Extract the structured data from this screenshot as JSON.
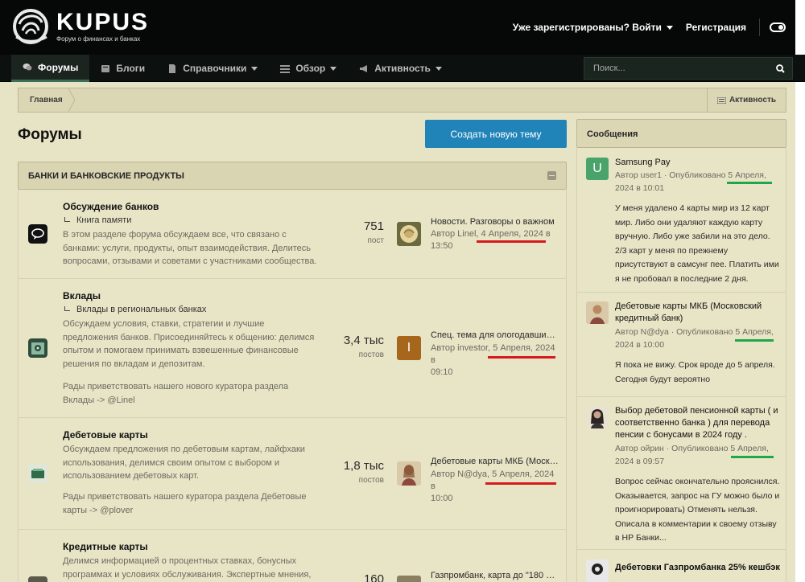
{
  "site": {
    "brand": "KUPUS",
    "tagline": "Форум о финансах и банках"
  },
  "header": {
    "login_label": "Уже зарегистрированы? Войти",
    "register_label": "Регистрация"
  },
  "nav": {
    "items": [
      {
        "label": "Форумы",
        "icon": "chat-bubbles-icon"
      },
      {
        "label": "Блоги",
        "icon": "book-icon"
      },
      {
        "label": "Справочники",
        "icon": "document-icon"
      },
      {
        "label": "Обзор",
        "icon": "list-icon"
      },
      {
        "label": "Активность",
        "icon": "megaphone-icon"
      }
    ],
    "search_placeholder": "Поиск..."
  },
  "breadcrumb": {
    "home": "Главная",
    "activity": "Активность"
  },
  "page": {
    "title": "Форумы",
    "create_button": "Создать новую тему"
  },
  "category": {
    "title": "БАНКИ И БАНКОВСКИЕ ПРОДУКТЫ"
  },
  "forums": [
    {
      "title": "Обсуждение банков",
      "subforum": "Книга памяти",
      "description": "В этом разделе форума обсуждаем все, что связано с банками: услуги, продукты, опыт взаимодействия. Делитесь вопросами, отзывами и советами с участниками сообщества.",
      "note": "",
      "count": "751",
      "count_label": "пост",
      "last_title": "Новости. Разговоры о важном",
      "last_author": "Автор Linel,",
      "last_date": "4 Апреля, 2024 в",
      "last_time": "13:50"
    },
    {
      "title": "Вклады",
      "subforum": "Вклады в региональных банках",
      "description": "Обсуждаем условия, ставки, стратегии и лучшие предложения банков. Присоединяйтесь к общению: делимся опытом и помогаем принимать взвешенные финансовые решения по вкладам и депозитам.",
      "note": "Рады приветствовать нашего нового куратора раздела Вклады -> @Linel",
      "count": "3,4 тыс",
      "count_label": "постов",
      "last_title": "Спец. тема для ологодавших ф...",
      "last_author": "Автор investor,",
      "last_date": "5 Апреля, 2024 в",
      "last_time": "09:10",
      "last_avatar_letter": "I"
    },
    {
      "title": "Дебетовые карты",
      "subforum": "",
      "description": "Обсуждаем предложения по дебетовым картам, лайфхаки использования, делимся своим опытом с выбором и использованием дебетовых карт.",
      "note": "Рады приветствовать нашего куратора раздела Дебетовые карты -> @plover",
      "count": "1,8 тыс",
      "count_label": "постов",
      "last_title": "Дебетовые карты МКБ (Моско...",
      "last_author": "Автор N@dya,",
      "last_date": "5 Апреля, 2024 в",
      "last_time": "10:00"
    },
    {
      "title": "Кредитные карты",
      "subforum": "",
      "description": "Делимся информацией о процентных ставках, бонусных программах и условиях обслуживания. Экспертные мнения,",
      "note": "",
      "count": "160",
      "count_label": "",
      "last_title": "Газпромбанк, карта до \"180 дн...",
      "last_author": "",
      "last_date": "",
      "last_time": ""
    }
  ],
  "sidebar": {
    "title": "Сообщения",
    "posts": [
      {
        "avatar_letter": "U",
        "title": "Samsung Pay",
        "meta_author": "Автор user1 · Опубликовано",
        "meta_date": "5 Апреля,",
        "meta_time": "2024 в 10:01",
        "body": "У меня удалено 4 карты мир из 12 карт мир. Либо они удаляют каждую карту вручную. Либо уже забили на это дело. 2/3 карт у меня по прежнему присутствуют в самсунг пее. Платить ими я не пробовал в последние 2 дня."
      },
      {
        "title": "Дебетовые карты МКБ (Московский кредитный банк)",
        "meta_author": "Автор N@dya · Опубликовано",
        "meta_date": "5 Апреля,",
        "meta_time": "2024 в 10:00",
        "body": "Я пока не вижу. Срок вроде до 5 апреля. Сегодня будут вероятно"
      },
      {
        "title": "Выбор дебетовой пенсионной карты ( и соответственно банка ) для перевода пенсии с бонусами в 2024 году .",
        "meta_author": "Автор ойрин · Опубликовано",
        "meta_date": "5 Апреля,",
        "meta_time": "2024 в 09:57",
        "body": "Вопрос сейчас окончательно прояснился. Оказывается, запрос на ГУ можно было и проигнорировать) Отменять нельзя. Описала в комментарии к своему отзыву в НР Банки..."
      },
      {
        "title": "Дебетовки Газпромбанка 25% кешбэк",
        "meta_author": "",
        "meta_date": "",
        "meta_time": "",
        "body": ""
      }
    ]
  },
  "colors": {
    "header_bg": "#060808",
    "page_bg": "#e7e3c5",
    "accent_button": "#2184b8",
    "highlight_red": "#d7191c",
    "highlight_green": "#21a74b"
  }
}
